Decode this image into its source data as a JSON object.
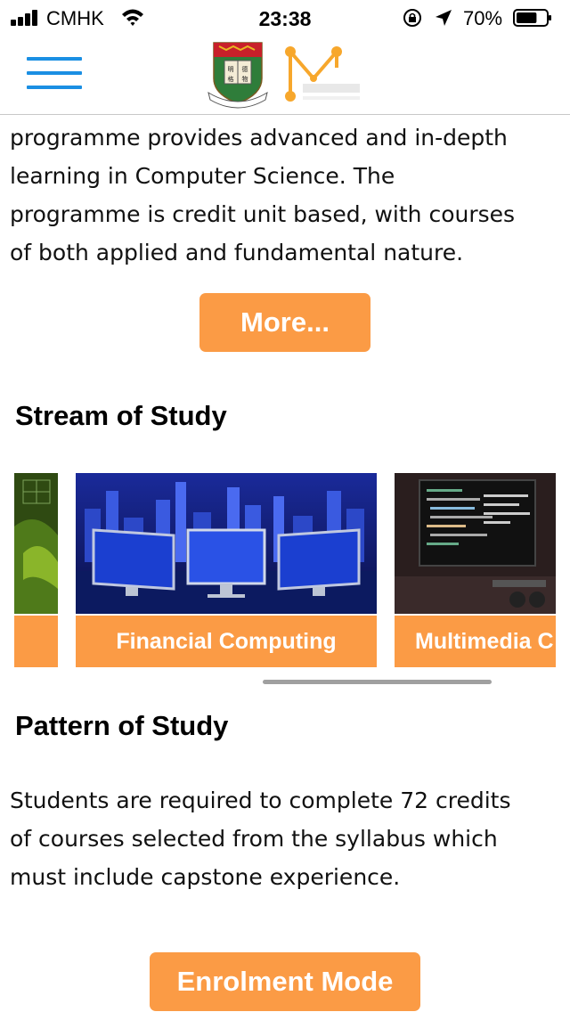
{
  "status_bar": {
    "carrier": "CMHK",
    "time": "23:38",
    "battery_percent": "70%",
    "battery_level": 0.7,
    "icons": [
      "signal-icon",
      "wifi-icon",
      "orientation-lock-icon",
      "location-arrow-icon",
      "battery-icon"
    ]
  },
  "header": {
    "menu_icon": "hamburger-menu-icon",
    "logos": [
      "hku-crest-logo",
      "mscs-logo"
    ],
    "accent_color": "#1a8fe3"
  },
  "intro": {
    "lines": [
      "programme provides advanced and in-depth",
      "learning in Computer Science.  The",
      "programme is credit unit based, with courses",
      "of both applied and fundamental nature."
    ],
    "more_label": "More..."
  },
  "stream": {
    "title": "Stream of Study",
    "cards": [
      {
        "label": ""
      },
      {
        "label": "Financial Computing"
      },
      {
        "label": "Multimedia C"
      }
    ]
  },
  "pattern": {
    "title": "Pattern of Study",
    "lines": [
      "Students are required to complete 72 credits",
      "of courses selected from the syllabus which",
      "must include capstone experience."
    ]
  },
  "enrolment": {
    "label": "Enrolment Mode"
  },
  "colors": {
    "button_orange": "#fb9b45",
    "menu_blue": "#1a8fe3"
  }
}
